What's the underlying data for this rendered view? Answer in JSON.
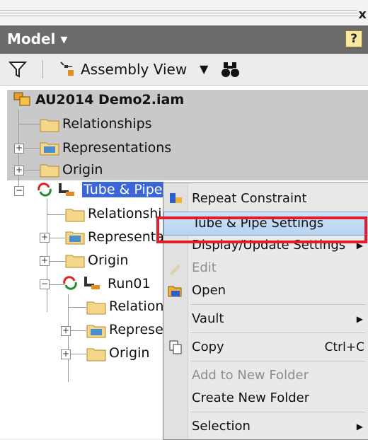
{
  "panel": {
    "title": "Model ▾",
    "help": "?",
    "close": "x"
  },
  "toolbar": {
    "view_label": "Assembly View",
    "dropdown": "▼"
  },
  "tree": {
    "root": "AU2014 Demo2.iam",
    "items": {
      "relationships": "Relationships",
      "representations": "Representations",
      "origin": "Origin",
      "tubepipe": "Tube & Pipe",
      "tp_relationships": "Relationshi",
      "tp_representations": "Representa",
      "tp_origin": "Origin",
      "run": "Run01",
      "run_relationships": "Relationships",
      "run_representations": "Representations",
      "run_origin": "Origin"
    },
    "expanders": {
      "plus": "+",
      "minus": "−"
    }
  },
  "context_menu": {
    "items": [
      {
        "label": "Repeat Constraint"
      },
      {
        "label": "Tube & Pipe Settings",
        "highlighted": true
      },
      {
        "label": "Display/Update Settings",
        "submenu": "▶"
      },
      {
        "label": "Edit",
        "disabled": true
      },
      {
        "label": "Open"
      },
      {
        "label": "Vault",
        "submenu": "▶"
      },
      {
        "label": "Copy",
        "shortcut": "Ctrl+C"
      },
      {
        "label": "Add to New Folder",
        "disabled": true
      },
      {
        "label": "Create New Folder"
      },
      {
        "label": "Selection",
        "submenu": "▶"
      }
    ]
  },
  "colors": {
    "header": "#6b6b6b",
    "selection": "#3a66d8",
    "annotation_box": "#e21d2a"
  }
}
